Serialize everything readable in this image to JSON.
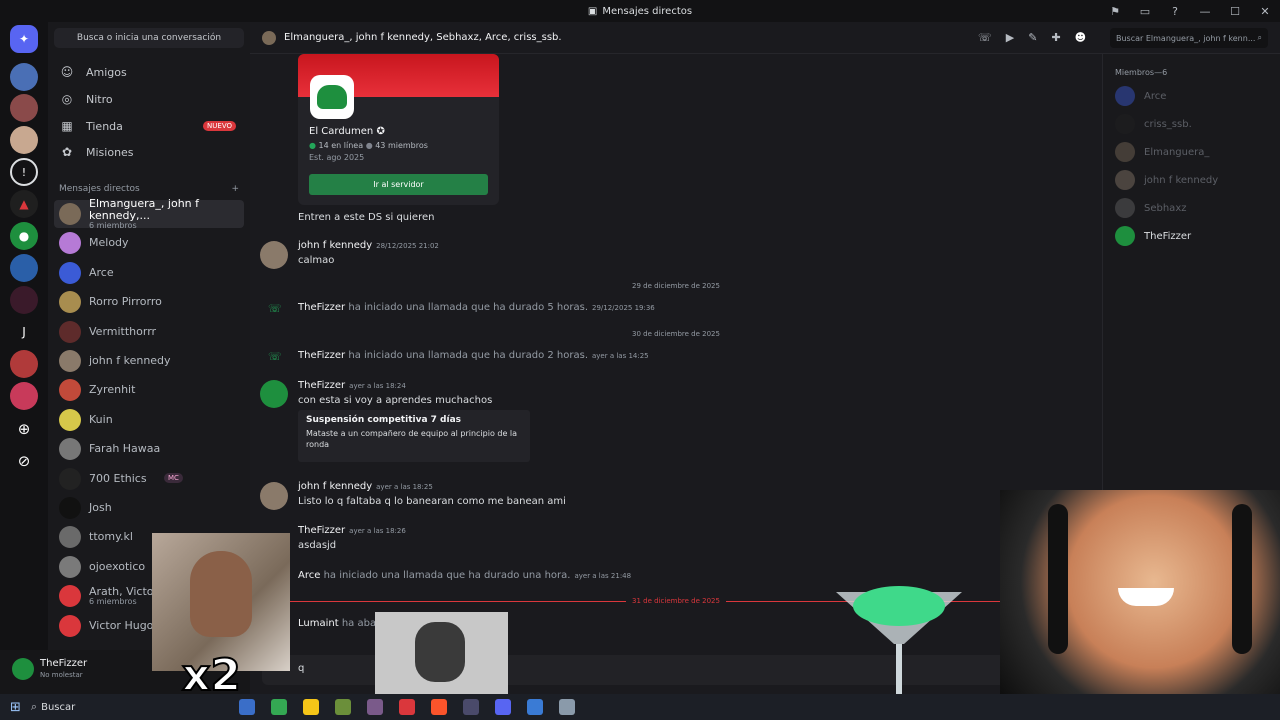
{
  "window": {
    "title": "Mensajes directos"
  },
  "search": {
    "label": "Busca o inicia una conversación"
  },
  "nav": [
    {
      "label": "Amigos",
      "icon": "friends-icon"
    },
    {
      "label": "Nitro",
      "icon": "nitro-icon"
    },
    {
      "label": "Tienda",
      "icon": "shop-icon",
      "badge": "NUEVO"
    },
    {
      "label": "Misiones",
      "icon": "quests-icon"
    }
  ],
  "dm_header": {
    "label": "Mensajes directos",
    "add": "+"
  },
  "dms": [
    {
      "name": "Elmanguera_, john f kennedy,...",
      "sub": "6 miembros",
      "color": "#7a6a58"
    },
    {
      "name": "Melody",
      "sub": "",
      "color": "#b67ad6"
    },
    {
      "name": "Arce",
      "sub": "",
      "color": "#3b5bd6"
    },
    {
      "name": "Rorro Pirrorro",
      "sub": "",
      "color": "#a88d4f"
    },
    {
      "name": "Vermitthorrr",
      "sub": "",
      "color": "#5e2b2b"
    },
    {
      "name": "john f kennedy",
      "sub": "",
      "color": "#8a7a6a"
    },
    {
      "name": "Zyrenhit",
      "sub": "",
      "color": "#c24a3a"
    },
    {
      "name": "Kuin",
      "sub": "",
      "color": "#d6c84a"
    },
    {
      "name": "Farah Hawaa",
      "sub": "",
      "color": "#777777"
    },
    {
      "name": "700 Ethics",
      "sub": "",
      "tag": "MC",
      "color": "#222222"
    },
    {
      "name": "Josh",
      "sub": "",
      "color": "#111111"
    },
    {
      "name": "ttomy.kl",
      "sub": "",
      "color": "#6a6a6a"
    },
    {
      "name": "ojoexotico",
      "sub": "",
      "color": "#7a7a7a"
    },
    {
      "name": "Arath, Victor",
      "sub": "6 miembros",
      "color": "#da373c"
    },
    {
      "name": "Victor Hugo",
      "sub": "",
      "color": "#da373c"
    }
  ],
  "user": {
    "name": "TheFizzer",
    "status": "No molestar"
  },
  "chat": {
    "title": "Elmanguera_, john f kennedy, Sebhaxz, Arce, criss_ssb.",
    "search_placeholder": "Buscar Elmanguera_, john f kenn..."
  },
  "invite": {
    "server": "El Cardumen",
    "online": "14 en línea",
    "members": "43 miembros",
    "est": "Est. ago 2025",
    "button": "Ir al servidor"
  },
  "messages": {
    "m0": {
      "text": "Entren a este DS si quieren"
    },
    "m1": {
      "author": "john f kennedy",
      "time": "28/12/2025 21:02",
      "text": "calmao"
    },
    "d1": "29 de diciembre de 2025",
    "c1": {
      "author": "TheFizzer",
      "text": "ha iniciado una llamada que ha durado 5 horas.",
      "time": "29/12/2025 19:36"
    },
    "d2": "30 de diciembre de 2025",
    "c2": {
      "author": "TheFizzer",
      "text": "ha iniciado una llamada que ha durado 2 horas.",
      "time": "ayer a las 14:25"
    },
    "m2": {
      "author": "TheFizzer",
      "time": "ayer a las 18:24",
      "text": "con esta si voy a aprendes muchachos"
    },
    "embed": {
      "title": "Suspensión competitiva 7 días",
      "desc": "Mataste a un compañero de equipo al principio de la ronda"
    },
    "m3": {
      "author": "john f kennedy",
      "time": "ayer a las 18:25",
      "text": "Listo lo q faltaba q lo banearan como me banean ami"
    },
    "m4": {
      "author": "TheFizzer",
      "time": "ayer a las 18:26",
      "text": "asdasjd"
    },
    "c3": {
      "author": "Arce",
      "text": "ha iniciado una llamada que ha durado una hora.",
      "time": "ayer a las 21:48"
    },
    "d3": "31 de diciembre de 2025",
    "c4": {
      "author": "Lumaint",
      "text": "ha abandonado el grupo."
    }
  },
  "composer": {
    "value": "q"
  },
  "members": {
    "header": "Miembros—6",
    "list": [
      {
        "name": "Arce",
        "color": "#3b5bd6"
      },
      {
        "name": "criss_ssb.",
        "color": "#222222"
      },
      {
        "name": "Elmanguera_",
        "color": "#7a6a58"
      },
      {
        "name": "john f kennedy",
        "color": "#8a7a6a"
      },
      {
        "name": "Sebhaxz",
        "color": "#666666"
      },
      {
        "name": "TheFizzer",
        "color": "#1e8f3e"
      }
    ]
  },
  "overlay": {
    "x2": "x2"
  },
  "taskbar": {
    "search": "Buscar"
  }
}
